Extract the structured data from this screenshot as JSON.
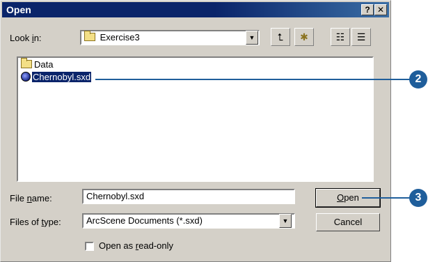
{
  "window": {
    "title": "Open",
    "help_label": "?",
    "close_label": "✕"
  },
  "lookin": {
    "label_pre": "Look ",
    "label_key": "i",
    "label_post": "n:",
    "value": "Exercise3",
    "dropdown_glyph": "▼"
  },
  "toolbar": {
    "up_glyph": "⮤",
    "new_folder_glyph": "✱",
    "list_view_glyph": "☷",
    "details_view_glyph": "☰"
  },
  "files": [
    {
      "name": "Data",
      "icon": "folder-icon",
      "selected": false
    },
    {
      "name": "Chernobyl.sxd",
      "icon": "sxd-document-icon",
      "selected": true
    }
  ],
  "filename": {
    "label_pre": "File ",
    "label_key": "n",
    "label_post": "ame:",
    "value": "Chernobyl.sxd"
  },
  "filetype": {
    "label_pre": "Files of ",
    "label_key": "t",
    "label_post": "ype:",
    "value": "ArcScene Documents (*.sxd)",
    "dropdown_glyph": "▼"
  },
  "readonly": {
    "label_pre": "Open as ",
    "label_key": "r",
    "label_post": "ead-only",
    "checked": false
  },
  "buttons": {
    "open_key": "O",
    "open_rest": "pen",
    "cancel": "Cancel"
  },
  "callouts": {
    "step_file": "2",
    "step_open": "3"
  },
  "colors": {
    "titlebar": "#0a246a",
    "dialog": "#d4d0c8",
    "callout": "#1f5e9b",
    "selection": "#0a246a"
  }
}
